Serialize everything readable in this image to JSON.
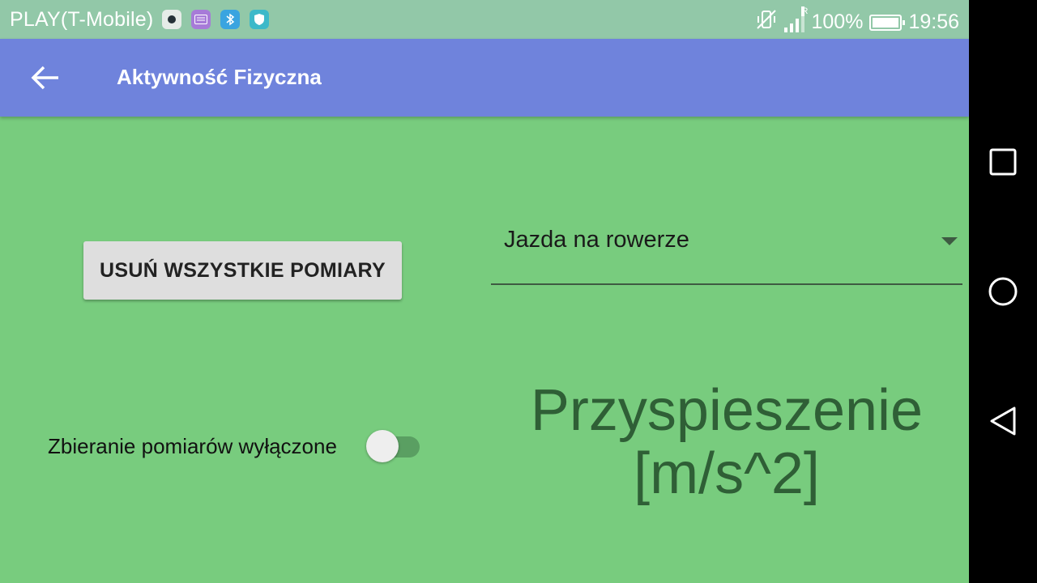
{
  "status_bar": {
    "carrier": "PLAY(T-Mobile)",
    "app_icons": [
      "camera-icon",
      "keyboard-icon",
      "bluetooth-icon",
      "shield-icon"
    ],
    "battery": "100%",
    "time": "19:56",
    "roaming_indicator": "R"
  },
  "app_bar": {
    "title": "Aktywność Fizyczna",
    "background": "#6f83dc"
  },
  "main": {
    "delete_button_label": "USUŃ WSZYSTKIE POMIARY",
    "activity_select": {
      "selected": "Jazda na rowerze"
    },
    "collect_switch": {
      "label": "Zbieranie pomiarów wyłączone",
      "on": false
    },
    "measurement_title_line1": "Przyspieszenie",
    "measurement_title_line2": "[m/s^2]",
    "background": "#78cc7e"
  },
  "nav_bar": {
    "buttons": [
      "recent-apps-icon",
      "home-icon",
      "back-icon"
    ]
  }
}
